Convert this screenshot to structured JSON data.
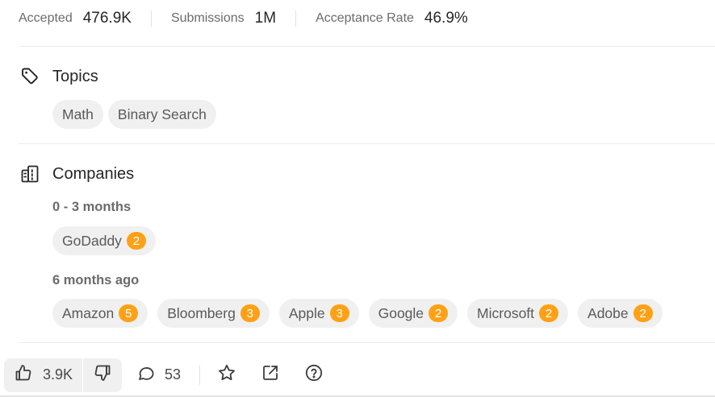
{
  "stats": [
    {
      "label": "Accepted",
      "value": "476.9K"
    },
    {
      "label": "Submissions",
      "value": "1M"
    },
    {
      "label": "Acceptance Rate",
      "value": "46.9%"
    }
  ],
  "topics": {
    "title": "Topics",
    "icon": "tag-icon",
    "tags": [
      "Math",
      "Binary Search"
    ]
  },
  "companies": {
    "title": "Companies",
    "icon": "building-icon",
    "groups": [
      {
        "period": "0 - 3 months",
        "items": [
          {
            "name": "GoDaddy",
            "count": "2"
          }
        ]
      },
      {
        "period": "6 months ago",
        "items": [
          {
            "name": "Amazon",
            "count": "5"
          },
          {
            "name": "Bloomberg",
            "count": "3"
          },
          {
            "name": "Apple",
            "count": "3"
          },
          {
            "name": "Google",
            "count": "2"
          },
          {
            "name": "Microsoft",
            "count": "2"
          },
          {
            "name": "Adobe",
            "count": "2"
          }
        ]
      }
    ]
  },
  "actions": {
    "likes": "3.9K",
    "comments": "53",
    "icons": [
      "thumbs-up-icon",
      "thumbs-down-icon",
      "comment-icon",
      "star-icon",
      "share-icon",
      "help-icon"
    ]
  },
  "colors": {
    "badge": "#ffa116",
    "tag_bg": "#f0f0f0",
    "text": "#262626",
    "muted": "#6b6b6b"
  }
}
